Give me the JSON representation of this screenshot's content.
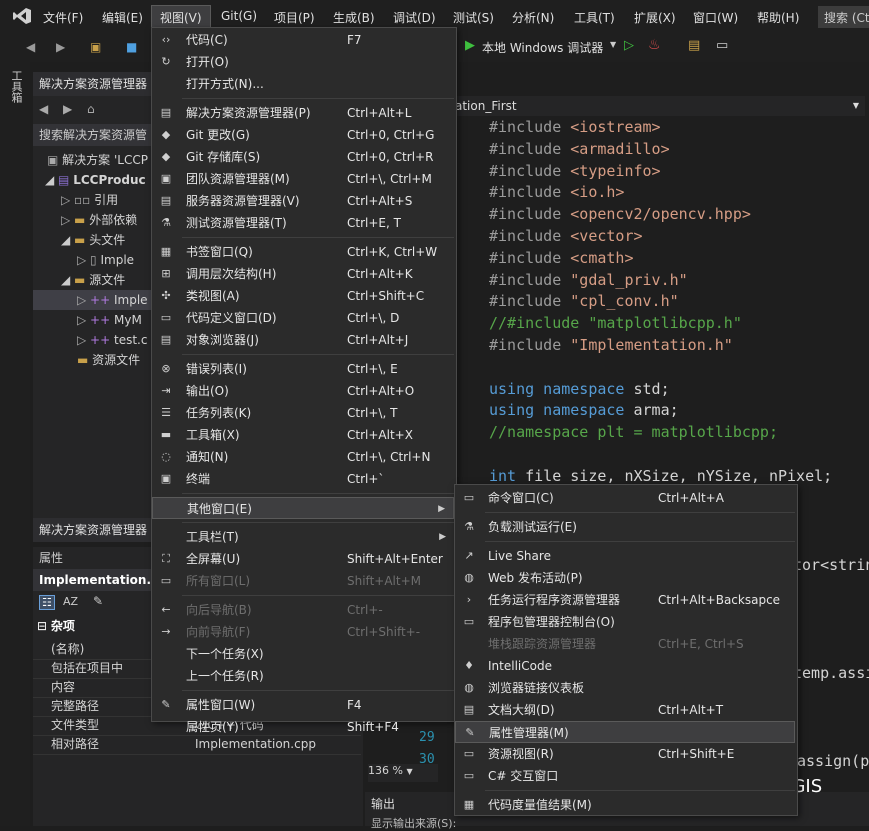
{
  "menubar": {
    "items": [
      "文件(F)",
      "编辑(E)",
      "视图(V)",
      "Git(G)",
      "项目(P)",
      "生成(B)",
      "调试(D)",
      "测试(S)",
      "分析(N)",
      "工具(T)",
      "扩展(X)",
      "窗口(W)",
      "帮助(H)"
    ],
    "search": "搜索 (Ct"
  },
  "toolbar": {
    "run_label": "本地 Windows 调试器"
  },
  "toolbox_tab": "工具箱",
  "solution_explorer": {
    "title": "解决方案资源管理器",
    "search": "搜索解决方案资源管",
    "items": [
      "解决方案 'LCCP",
      "LCCProduc",
      "引用",
      "外部依赖",
      "头文件",
      "Imple",
      "源文件",
      "Imple",
      "MyM",
      "test.c",
      "资源文件"
    ],
    "bottom_tab": "解决方案资源管理器"
  },
  "properties": {
    "title": "属性",
    "file": "Implementation.cp",
    "section": "杂项",
    "rows": [
      {
        "k": "(名称)",
        "v": ""
      },
      {
        "k": "包括在项目中",
        "v": ""
      },
      {
        "k": "内容",
        "v": ""
      },
      {
        "k": "完整路径",
        "v": ""
      },
      {
        "k": "文件类型",
        "v": "C/C++ 代码"
      },
      {
        "k": "相对路径",
        "v": "Implementation.cpp"
      }
    ]
  },
  "editor": {
    "nav": "ation_First",
    "lines": [
      {
        "parts": [
          [
            "inc",
            "#include "
          ],
          [
            "str",
            "<iostream>"
          ]
        ]
      },
      {
        "parts": [
          [
            "inc",
            "#include "
          ],
          [
            "str",
            "<armadillo>"
          ]
        ]
      },
      {
        "parts": [
          [
            "inc",
            "#include "
          ],
          [
            "str",
            "<typeinfo>"
          ]
        ]
      },
      {
        "parts": [
          [
            "inc",
            "#include "
          ],
          [
            "str",
            "<io.h>"
          ]
        ]
      },
      {
        "parts": [
          [
            "inc",
            "#include "
          ],
          [
            "str",
            "<opencv2/opencv.hpp>"
          ]
        ]
      },
      {
        "parts": [
          [
            "inc",
            "#include "
          ],
          [
            "str",
            "<vector>"
          ]
        ]
      },
      {
        "parts": [
          [
            "inc",
            "#include "
          ],
          [
            "str",
            "<cmath>"
          ]
        ]
      },
      {
        "parts": [
          [
            "inc",
            "#include "
          ],
          [
            "str",
            "\"gdal_priv.h\""
          ]
        ]
      },
      {
        "parts": [
          [
            "inc",
            "#include "
          ],
          [
            "str",
            "\"cpl_conv.h\""
          ]
        ]
      },
      {
        "parts": [
          [
            "com",
            "//#include \"matplotlibcpp.h\""
          ]
        ]
      },
      {
        "parts": [
          [
            "inc",
            "#include "
          ],
          [
            "str",
            "\"Implementation.h\""
          ]
        ]
      },
      {
        "parts": [
          [
            "",
            ""
          ]
        ]
      },
      {
        "parts": [
          [
            "kw",
            "using namespace "
          ],
          [
            "",
            "std;"
          ]
        ]
      },
      {
        "parts": [
          [
            "kw",
            "using namespace "
          ],
          [
            "",
            "arma;"
          ]
        ]
      },
      {
        "parts": [
          [
            "com",
            "//namespace plt = matplotlibcpp;"
          ]
        ]
      },
      {
        "parts": [
          [
            "",
            ""
          ]
        ]
      },
      {
        "parts": [
          [
            "kw",
            "int "
          ],
          [
            "",
            "file_size, nXSize, nYSize, nPixel;"
          ]
        ]
      }
    ],
    "frag1": "tor<strin",
    "frag2": "temp.assi",
    "frag3": "assign(p",
    "line_numbers": [
      "29",
      "30"
    ]
  },
  "zoom": "136 %",
  "output": {
    "title": "输出",
    "source": "显示输出来源(S):"
  },
  "watermark": "疯狂学习GIS",
  "view_menu": [
    {
      "icon": "‹›",
      "label": "代码(C)",
      "shortcut": "F7"
    },
    {
      "icon": "↻",
      "label": "打开(O)",
      "shortcut": ""
    },
    {
      "icon": "",
      "label": "打开方式(N)...",
      "shortcut": ""
    },
    {
      "sep": true
    },
    {
      "icon": "▤",
      "label": "解决方案资源管理器(P)",
      "shortcut": "Ctrl+Alt+L"
    },
    {
      "icon": "◆",
      "label": "Git 更改(G)",
      "shortcut": "Ctrl+0, Ctrl+G"
    },
    {
      "icon": "◆",
      "label": "Git 存储库(S)",
      "shortcut": "Ctrl+0, Ctrl+R"
    },
    {
      "icon": "▣",
      "label": "团队资源管理器(M)",
      "shortcut": "Ctrl+\\, Ctrl+M"
    },
    {
      "icon": "▤",
      "label": "服务器资源管理器(V)",
      "shortcut": "Ctrl+Alt+S"
    },
    {
      "icon": "⚗",
      "label": "测试资源管理器(T)",
      "shortcut": "Ctrl+E, T"
    },
    {
      "sep": true
    },
    {
      "icon": "▦",
      "label": "书签窗口(Q)",
      "shortcut": "Ctrl+K, Ctrl+W"
    },
    {
      "icon": "⊞",
      "label": "调用层次结构(H)",
      "shortcut": "Ctrl+Alt+K"
    },
    {
      "icon": "✣",
      "label": "类视图(A)",
      "shortcut": "Ctrl+Shift+C"
    },
    {
      "icon": "▭",
      "label": "代码定义窗口(D)",
      "shortcut": "Ctrl+\\, D"
    },
    {
      "icon": "▤",
      "label": "对象浏览器(J)",
      "shortcut": "Ctrl+Alt+J"
    },
    {
      "sep": true
    },
    {
      "icon": "⊗",
      "label": "错误列表(I)",
      "shortcut": "Ctrl+\\, E"
    },
    {
      "icon": "⇥",
      "label": "输出(O)",
      "shortcut": "Ctrl+Alt+O"
    },
    {
      "icon": "☰",
      "label": "任务列表(K)",
      "shortcut": "Ctrl+\\, T"
    },
    {
      "icon": "▬",
      "label": "工具箱(X)",
      "shortcut": "Ctrl+Alt+X"
    },
    {
      "icon": "◌",
      "label": "通知(N)",
      "shortcut": "Ctrl+\\, Ctrl+N"
    },
    {
      "icon": "▣",
      "label": "终端",
      "shortcut": "Ctrl+`"
    },
    {
      "sep": true
    },
    {
      "icon": "",
      "label": "其他窗口(E)",
      "shortcut": "",
      "sub": true,
      "hl": true
    },
    {
      "sep": true
    },
    {
      "icon": "",
      "label": "工具栏(T)",
      "shortcut": "",
      "sub": true
    },
    {
      "icon": "⛶",
      "label": "全屏幕(U)",
      "shortcut": "Shift+Alt+Enter"
    },
    {
      "icon": "▭",
      "label": "所有窗口(L)",
      "shortcut": "Shift+Alt+M",
      "dis": true
    },
    {
      "sep": true
    },
    {
      "icon": "←",
      "label": "向后导航(B)",
      "shortcut": "Ctrl+-",
      "dis": true
    },
    {
      "icon": "→",
      "label": "向前导航(F)",
      "shortcut": "Ctrl+Shift+-",
      "dis": true
    },
    {
      "icon": "",
      "label": "下一个任务(X)",
      "shortcut": ""
    },
    {
      "icon": "",
      "label": "上一个任务(R)",
      "shortcut": ""
    },
    {
      "sep": true
    },
    {
      "icon": "✎",
      "label": "属性窗口(W)",
      "shortcut": "F4"
    },
    {
      "icon": "",
      "label": "属性页(Y)",
      "shortcut": "Shift+F4"
    }
  ],
  "other_menu": [
    {
      "icon": "▭",
      "label": "命令窗口(C)",
      "shortcut": "Ctrl+Alt+A"
    },
    {
      "sep": true
    },
    {
      "icon": "⚗",
      "label": "负载测试运行(E)",
      "shortcut": ""
    },
    {
      "sep": true
    },
    {
      "icon": "↗",
      "label": "Live Share",
      "shortcut": ""
    },
    {
      "icon": "◍",
      "label": "Web 发布活动(P)",
      "shortcut": ""
    },
    {
      "icon": "›",
      "label": "任务运行程序资源管理器",
      "shortcut": "Ctrl+Alt+Backsapce"
    },
    {
      "icon": "▭",
      "label": "程序包管理器控制台(O)",
      "shortcut": ""
    },
    {
      "icon": "",
      "label": "堆栈跟踪资源管理器",
      "shortcut": "Ctrl+E, Ctrl+S",
      "dis": true
    },
    {
      "icon": "♦",
      "label": "IntelliCode",
      "shortcut": ""
    },
    {
      "icon": "◍",
      "label": "浏览器链接仪表板",
      "shortcut": ""
    },
    {
      "icon": "▤",
      "label": "文档大纲(D)",
      "shortcut": "Ctrl+Alt+T"
    },
    {
      "icon": "✎",
      "label": "属性管理器(M)",
      "shortcut": "",
      "hl": true
    },
    {
      "icon": "▭",
      "label": "资源视图(R)",
      "shortcut": "Ctrl+Shift+E"
    },
    {
      "icon": "▭",
      "label": "C# 交互窗口",
      "shortcut": ""
    },
    {
      "sep": true
    },
    {
      "icon": "▦",
      "label": "代码度量值结果(M)",
      "shortcut": ""
    }
  ],
  "colors": {
    "accent": "#3e3e40",
    "bg": "#1e1e1e",
    "menu": "#2b2b2b"
  }
}
